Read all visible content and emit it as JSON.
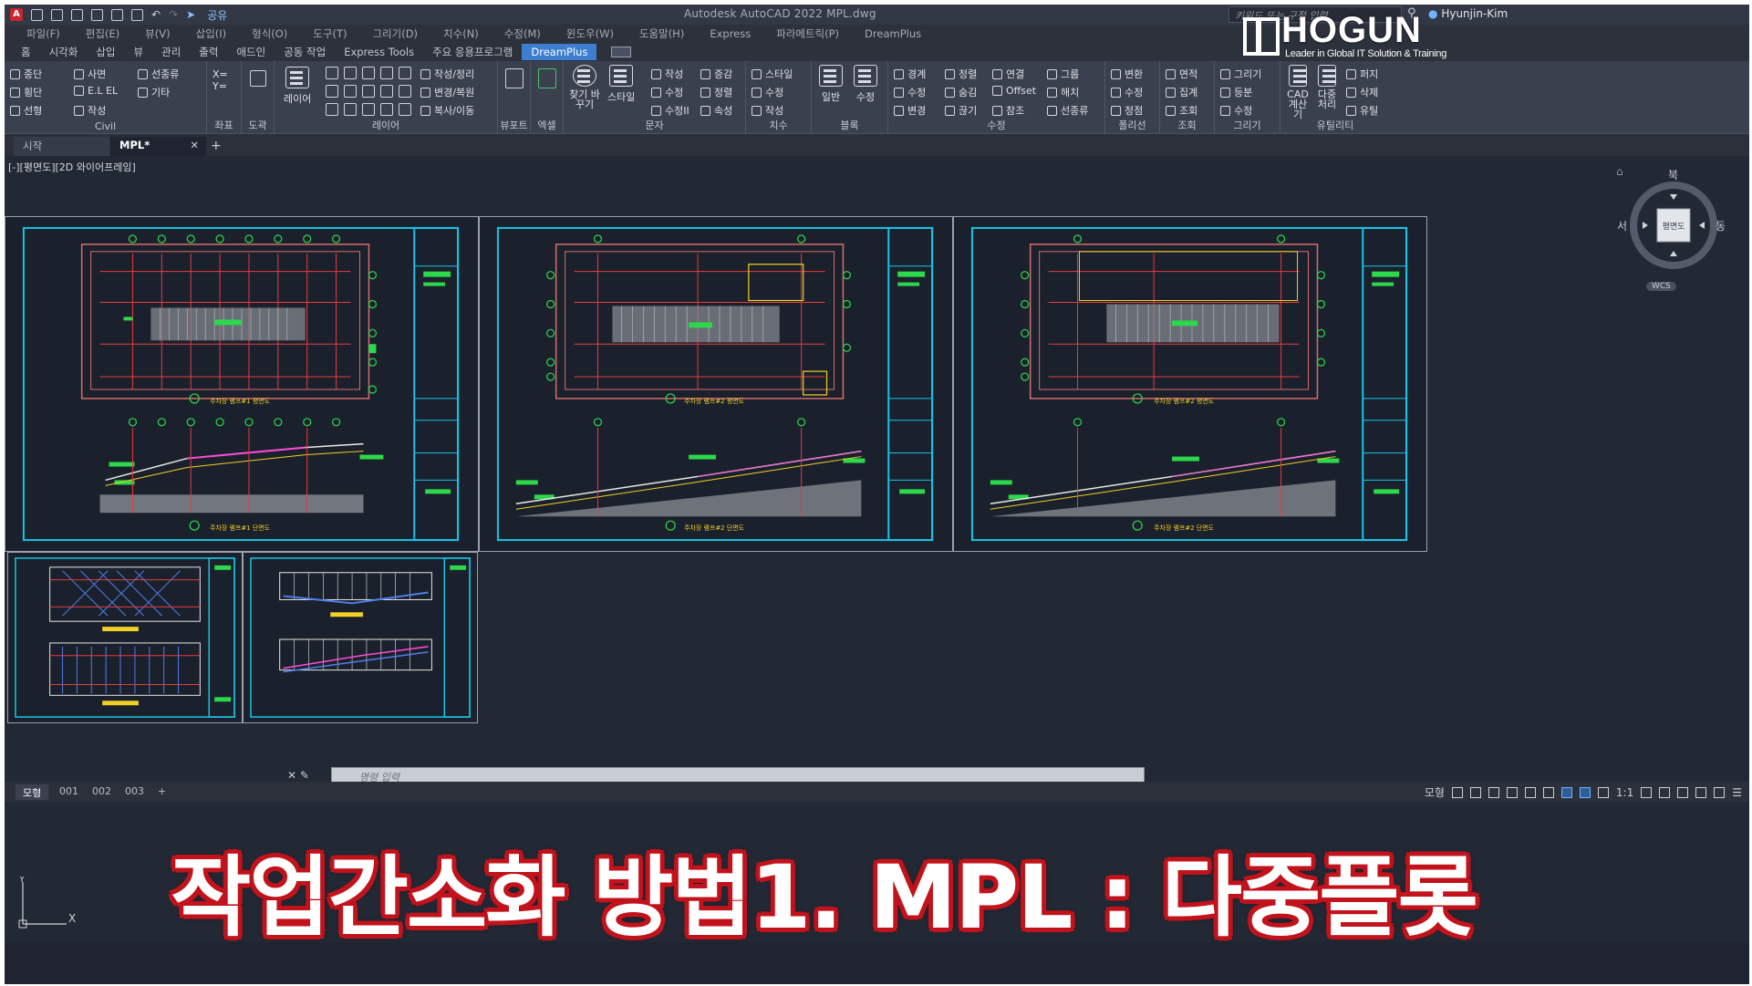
{
  "titlebar": {
    "app_title": "Autodesk AutoCAD 2022    MPL.dwg",
    "share_label": "공유",
    "search_placeholder": "키워드 또는 구절 입력",
    "user_name": "Hyunjin-Kim"
  },
  "menu": [
    "파일(F)",
    "편집(E)",
    "뷰(V)",
    "삽입(I)",
    "형식(O)",
    "도구(T)",
    "그리기(D)",
    "치수(N)",
    "수정(M)",
    "윈도우(W)",
    "도움말(H)",
    "Express",
    "파라메트릭(P)",
    "DreamPlus"
  ],
  "ribbon_tabs": [
    "홈",
    "시각화",
    "삽입",
    "뷰",
    "관리",
    "출력",
    "애드인",
    "공동 작업",
    "Express Tools",
    "주요 응용프로그램",
    "DreamPlus"
  ],
  "ribbon_active_tab": "DreamPlus",
  "ribbon": {
    "civil": {
      "label": "Civil",
      "cmds": [
        "종단",
        "사면",
        "선종류",
        "횡단",
        "E.L EL",
        "기타",
        "선형",
        "작성"
      ]
    },
    "coord": {
      "label": "좌표",
      "cmds": [
        "X= Y="
      ]
    },
    "drawing": {
      "label": "도곽"
    },
    "layer": {
      "label": "레이어",
      "big": "레이어",
      "cmds": [
        "작성/정리",
        "변경/복원",
        "복사/이동"
      ]
    },
    "viewport": {
      "label": "뷰포트"
    },
    "excel": {
      "label": "엑셀"
    },
    "text": {
      "label": "문자",
      "big1": "찾기 바꾸기",
      "big2": "스타일",
      "cmds": [
        "작성",
        "증감",
        "수정",
        "정렬",
        "수정II",
        "속성"
      ]
    },
    "dim": {
      "label": "치수",
      "cmds": [
        "스타일",
        "수정",
        "작성"
      ]
    },
    "block": {
      "label": "블록",
      "big1": "일반",
      "big2": "수정"
    },
    "modify": {
      "label": "수정",
      "cmds": [
        "경계",
        "정렬",
        "연결",
        "그룹",
        "수정",
        "숨김",
        "Offset",
        "해치",
        "변경",
        "끊기",
        "참조",
        "선종류"
      ]
    },
    "polyline": {
      "label": "폴리선",
      "cmds": [
        "변환",
        "수정",
        "정점"
      ]
    },
    "query": {
      "label": "조회",
      "cmds": [
        "면적",
        "집계",
        "조회"
      ]
    },
    "draw": {
      "label": "그리기",
      "cmds": [
        "그리기",
        "등분",
        "수정"
      ]
    },
    "utility": {
      "label": "유틸리티",
      "big1": "CAD 계산기",
      "big2": "다중 처리",
      "cmds": [
        "퍼지",
        "삭제",
        "유틸"
      ]
    }
  },
  "file_tabs": {
    "start": "시작",
    "active": "MPL*"
  },
  "viewport_label": "[-][평면도][2D 와이어프레임]",
  "viewcube": {
    "north": "북",
    "west": "서",
    "east": "동",
    "face": "평면도",
    "wcs": "WCS"
  },
  "drawings": [
    {
      "plan_title": "주차장 램프#1 평면도",
      "section_title": "주차장 램프#1 단면도"
    },
    {
      "plan_title": "주차장 램프#2 평면도",
      "section_title": "주차장 램프#2 단면도"
    },
    {
      "plan_title": "주차장 램프#2 평면도",
      "section_title": "주차장 램프#2 단면도"
    }
  ],
  "overlay_title": "작업간소화 방법1. MPL : 다중플롯",
  "brand": {
    "name": "HOGUN",
    "tagline": "Leader in Global IT Solution & Training"
  },
  "command_placeholder": "명령 입력",
  "layout_tabs": [
    "모형",
    "001",
    "002",
    "003"
  ],
  "status": {
    "model": "모형",
    "scale": "1:1"
  },
  "colors": {
    "accent": "#3d7ed0",
    "overlay_text": "#ffffff",
    "overlay_outline": "#c2121b",
    "frame": "#19c3e6"
  }
}
